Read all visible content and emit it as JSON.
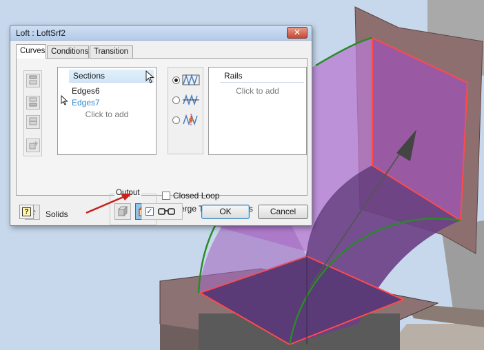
{
  "dialog": {
    "title": "Loft : LoftSrf2",
    "close_symbol": "✕"
  },
  "tabs": [
    {
      "label": "Curves",
      "active": true
    },
    {
      "label": "Conditions",
      "active": false
    },
    {
      "label": "Transition",
      "active": false
    }
  ],
  "sections": {
    "header": "Sections",
    "items": [
      {
        "label": "Edges6",
        "active": false
      },
      {
        "label": "Edges7",
        "active": true
      }
    ],
    "click_to_add": "Click to add"
  },
  "rails": {
    "header": "Rails",
    "click_to_add": "Click to add"
  },
  "solids": {
    "label": "Solids"
  },
  "output": {
    "label": "Output",
    "selected": "surface"
  },
  "options": {
    "closed_loop": {
      "label": "Closed Loop",
      "checked": false
    },
    "merge_tangent_faces": {
      "label": "Merge Tangent Faces",
      "checked": false
    }
  },
  "preview": {
    "checked": true,
    "check_symbol": "✓"
  },
  "buttons": {
    "help_symbol": "?",
    "ok": "OK",
    "cancel": "Cancel"
  },
  "colors": {
    "loft_surface": "#b070c8",
    "edge_highlight": "#ff4a4a",
    "profile_curve": "#2a8a2a",
    "plate": "#8c6a6a",
    "annotation_arrow": "#c8201a"
  }
}
